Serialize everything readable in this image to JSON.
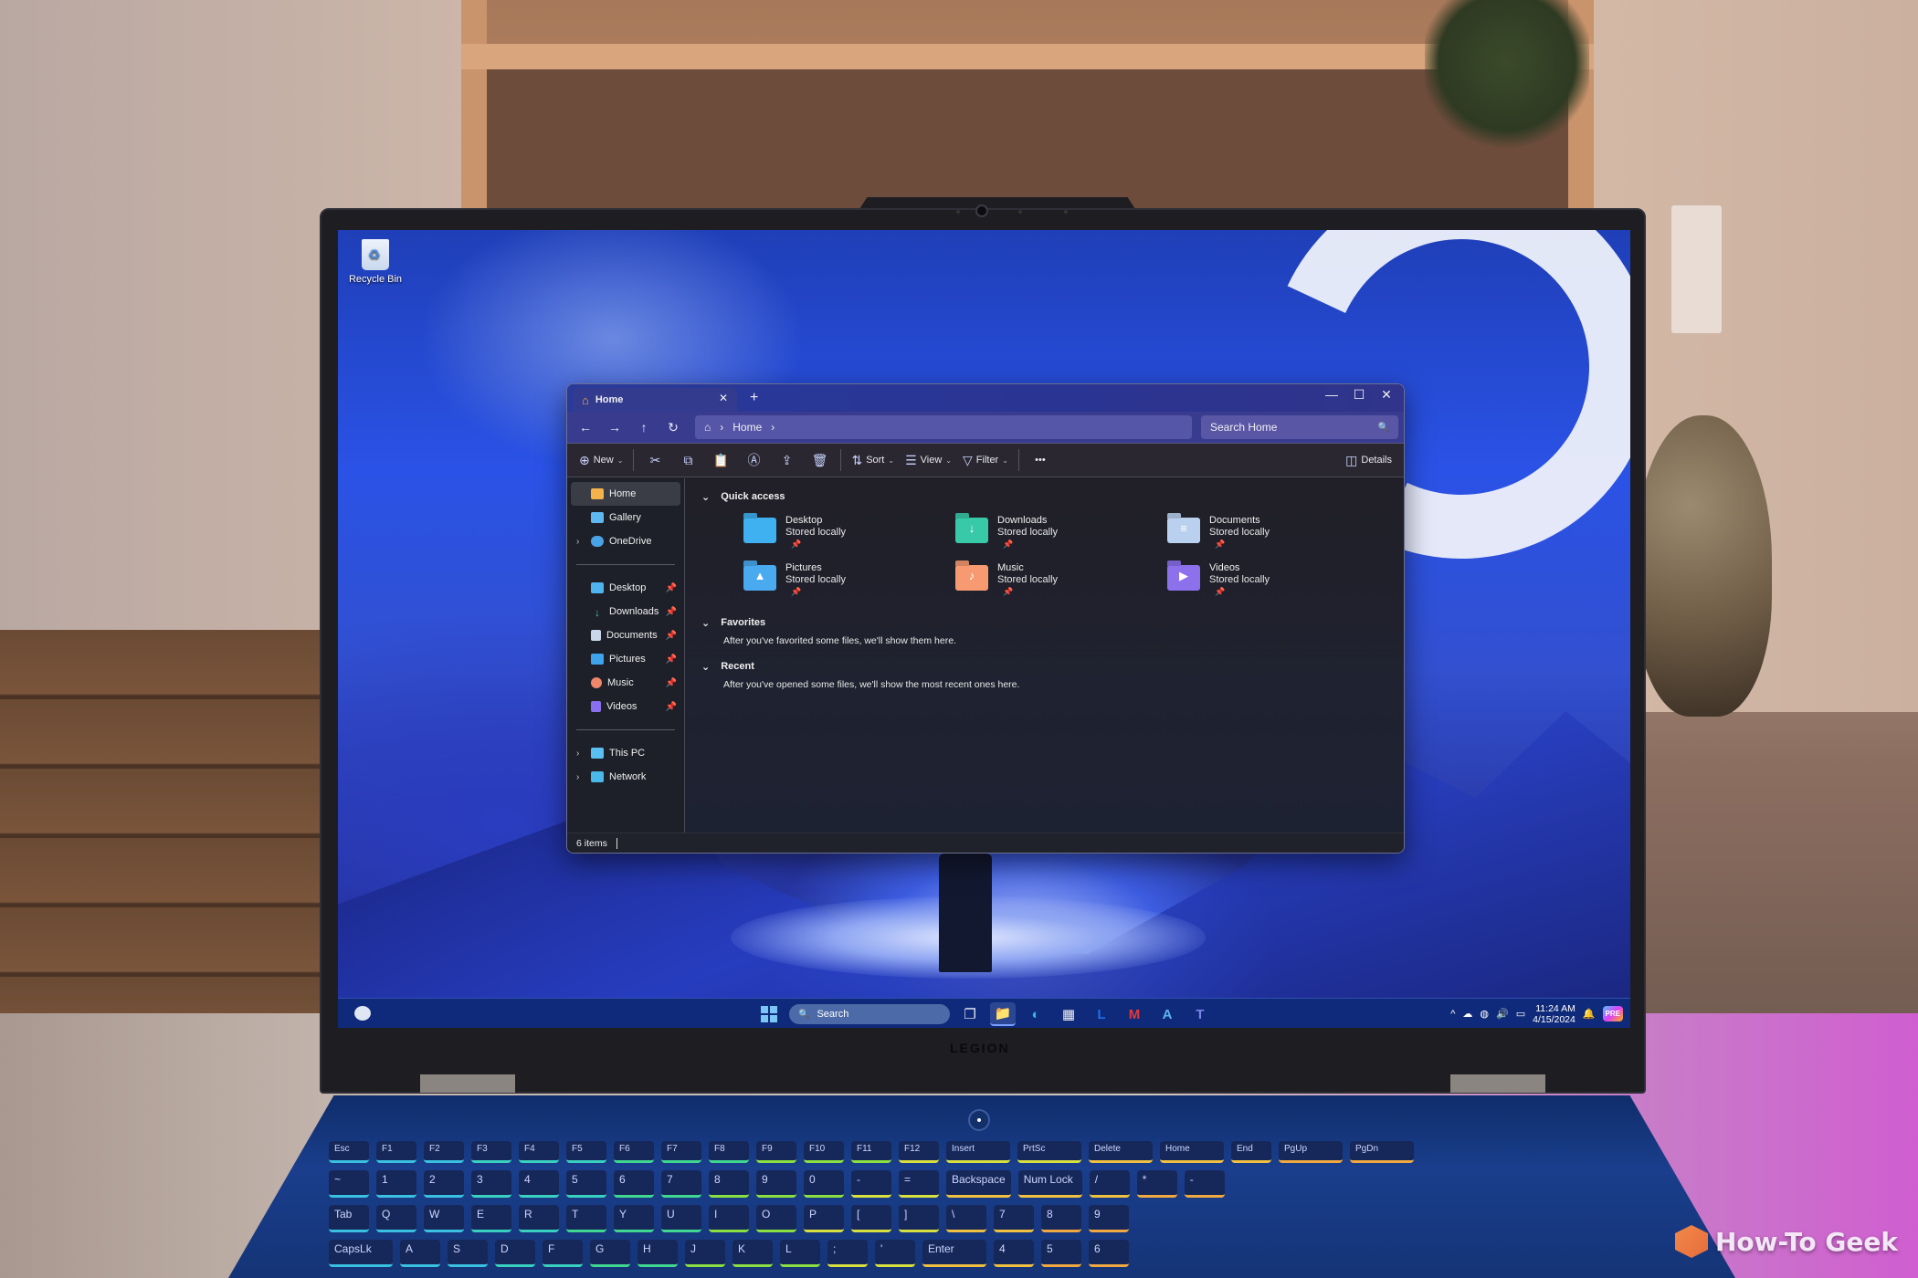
{
  "desktop": {
    "icons": [
      {
        "label": "Recycle Bin",
        "icon": "recycle-bin-icon"
      }
    ]
  },
  "explorer": {
    "tab": {
      "icon": "home-icon",
      "label": "Home",
      "close_glyph": "✕"
    },
    "new_tab_glyph": "+",
    "window_controls": {
      "minimize": "—",
      "maximize": "☐",
      "close": "✕"
    },
    "nav": {
      "back": "←",
      "forward": "→",
      "up": "↑",
      "refresh": "↻"
    },
    "address": {
      "home_glyph": "⌂",
      "sep": "›",
      "crumbs": [
        "Home"
      ],
      "trail": "›"
    },
    "search": {
      "placeholder": "Search Home",
      "icon_glyph": "🔍"
    },
    "toolbar": {
      "new_label": "New",
      "new_glyph": "⊕",
      "cut_glyph": "✂",
      "copy_glyph": "⧉",
      "paste_glyph": "📋",
      "rename_glyph": "Ⓐ",
      "share_glyph": "⇪",
      "delete_glyph": "🗑",
      "sort_label": "Sort",
      "sort_glyph": "⇅",
      "view_label": "View",
      "view_glyph": "☰",
      "filter_label": "Filter",
      "filter_glyph": "▽",
      "more_glyph": "•••",
      "details_label": "Details",
      "details_glyph": "◫",
      "caret": "⌄"
    },
    "sidebar": {
      "top": [
        {
          "label": "Home",
          "icon": "home-icon",
          "color": "#f3b24a",
          "active": true
        },
        {
          "label": "Gallery",
          "icon": "gallery-icon",
          "color": "#5fb7f0"
        },
        {
          "label": "OneDrive",
          "icon": "onedrive-icon",
          "color": "#4aa3e6",
          "expandable": true
        }
      ],
      "pinned": [
        {
          "label": "Desktop",
          "icon": "desktop-folder-icon",
          "color": "#4fb4ee"
        },
        {
          "label": "Downloads",
          "icon": "downloads-icon",
          "color": "#3cc9a5"
        },
        {
          "label": "Documents",
          "icon": "documents-icon",
          "color": "#c9d6ea"
        },
        {
          "label": "Pictures",
          "icon": "pictures-icon",
          "color": "#3ea3ea"
        },
        {
          "label": "Music",
          "icon": "music-icon",
          "color": "#f0866a"
        },
        {
          "label": "Videos",
          "icon": "videos-icon",
          "color": "#8a6ef0"
        }
      ],
      "bottom": [
        {
          "label": "This PC",
          "icon": "this-pc-icon",
          "color": "#5ac0f2"
        },
        {
          "label": "Network",
          "icon": "network-icon",
          "color": "#4ab8e8"
        }
      ],
      "pin_glyph": "📌",
      "chevron_glyph": "›"
    },
    "sections": {
      "quick_access": {
        "title": "Quick access",
        "items": [
          {
            "name": "Desktop",
            "sub": "Stored locally",
            "icon": "desktop-folder-icon",
            "color": "#3fb0f0",
            "glyph": ""
          },
          {
            "name": "Downloads",
            "sub": "Stored locally",
            "icon": "downloads-folder-icon",
            "color": "#37c9a8",
            "glyph": "↓"
          },
          {
            "name": "Documents",
            "sub": "Stored locally",
            "icon": "documents-folder-icon",
            "color": "#b9d1ee",
            "glyph": "≡"
          },
          {
            "name": "Pictures",
            "sub": "Stored locally",
            "icon": "pictures-folder-icon",
            "color": "#4aaaf0",
            "glyph": "▲"
          },
          {
            "name": "Music",
            "sub": "Stored locally",
            "icon": "music-folder-icon",
            "color": "#f79a72",
            "glyph": "♪"
          },
          {
            "name": "Videos",
            "sub": "Stored locally",
            "icon": "videos-folder-icon",
            "color": "#8c70ec",
            "glyph": "▶"
          }
        ]
      },
      "favorites": {
        "title": "Favorites",
        "empty": "After you've favorited some files, we'll show them here."
      },
      "recent": {
        "title": "Recent",
        "empty": "After you've opened some files, we'll show the most recent ones here."
      },
      "chevron_glyph": "⌄"
    },
    "status": {
      "count": "6 items"
    }
  },
  "taskbar": {
    "search_label": "Search",
    "search_glyph": "🔍",
    "apps": [
      {
        "name": "task-view",
        "glyph": "❐",
        "color": "#e8ecf4"
      },
      {
        "name": "file-explorer",
        "glyph": "📁",
        "color": "#f5c542",
        "active": true
      },
      {
        "name": "edge",
        "glyph": "◐",
        "color": "#35b6e8"
      },
      {
        "name": "microsoft-store",
        "glyph": "▦",
        "color": "#f4f4f4"
      },
      {
        "name": "lenovo-vantage",
        "glyph": "L",
        "color": "#1f6fe6"
      },
      {
        "name": "mcafee",
        "glyph": "M",
        "color": "#e23a3a"
      },
      {
        "name": "app-a",
        "glyph": "A",
        "color": "#5fb2f2"
      },
      {
        "name": "teams",
        "glyph": "T",
        "color": "#7b83eb"
      }
    ],
    "tray": {
      "chevron": "^",
      "onedrive_glyph": "☁",
      "network_glyph": "◍",
      "volume_glyph": "🔊",
      "battery_glyph": "▭",
      "time": "11:24 AM",
      "date": "4/15/2024",
      "bell_glyph": "🔔",
      "copilot_badge": "PRE"
    }
  },
  "hardware": {
    "brand": "LEGION",
    "keyboard": {
      "fn_row": [
        "Esc",
        "F1",
        "F2",
        "F3",
        "F4",
        "F5",
        "F6",
        "F7",
        "F8",
        "F9",
        "F10",
        "F11",
        "F12",
        "Insert",
        "PrtSc",
        "Delete",
        "Home",
        "End",
        "PgUp",
        "PgDn"
      ],
      "num_row": [
        "~",
        "1",
        "2",
        "3",
        "4",
        "5",
        "6",
        "7",
        "8",
        "9",
        "0",
        "-",
        "=",
        "Backspace",
        "Num Lock",
        "/",
        "*",
        "-"
      ],
      "top_row": [
        "Tab",
        "Q",
        "W",
        "E",
        "R",
        "T",
        "Y",
        "U",
        "I",
        "O",
        "P",
        "[",
        "]",
        "\\",
        "7",
        "8",
        "9"
      ],
      "home_row": [
        "CapsLk",
        "A",
        "S",
        "D",
        "F",
        "G",
        "H",
        "J",
        "K",
        "L",
        ";",
        "'",
        "Enter",
        "4",
        "5",
        "6"
      ]
    }
  },
  "watermark": {
    "text": "How-To Geek"
  }
}
